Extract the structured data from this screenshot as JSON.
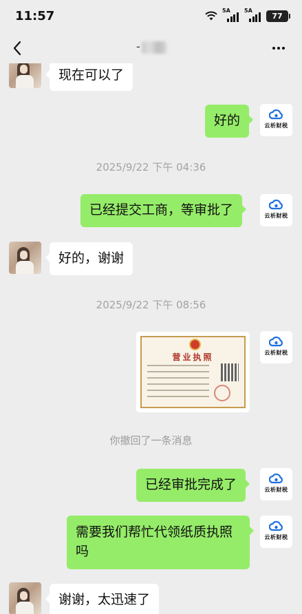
{
  "status_bar": {
    "time": "11:57",
    "signal1_label": "5A",
    "signal2_label": "5A",
    "battery": "77"
  },
  "nav": {
    "title_visible": "-"
  },
  "messages": [
    {
      "side": "left",
      "text": "现在可以了"
    },
    {
      "side": "right",
      "text": "好的"
    },
    {
      "type": "time",
      "text": "2025/9/22 下午 04:36"
    },
    {
      "side": "right",
      "text": "已经提交工商，等审批了"
    },
    {
      "side": "left",
      "text": "好的，谢谢"
    },
    {
      "type": "time",
      "text": "2025/9/22 下午 08:56"
    },
    {
      "side": "right",
      "type": "image",
      "image": {
        "title": "营业执照"
      }
    },
    {
      "type": "system",
      "text": "你撤回了一条消息"
    },
    {
      "side": "right",
      "text": "已经审批完成了"
    },
    {
      "side": "right",
      "text_line1": "需要我们帮忙代领纸质执照",
      "text_line2": "吗"
    },
    {
      "side": "left",
      "text": "谢谢，太迅速了"
    }
  ],
  "self_avatar": {
    "brand": "云析财税",
    "icon": "cloud-icon",
    "color": "#1d6fe0"
  },
  "colors": {
    "background": "#ededed",
    "bubble_self": "#95ec69",
    "bubble_other": "#ffffff"
  }
}
